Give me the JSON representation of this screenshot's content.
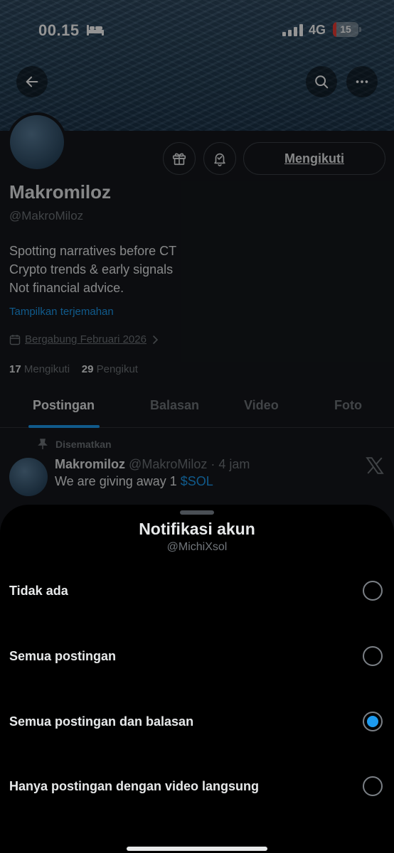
{
  "status_bar": {
    "time": "00.15",
    "network": "4G",
    "battery": "15",
    "battery_level": 0.15,
    "battery_color": "#eb3b35"
  },
  "profile": {
    "name": "Makromiloz",
    "handle": "@MakroMiloz",
    "follow_button": "Mengikuti",
    "bio_lines": [
      "Spotting narratives before CT",
      "Crypto trends & early signals",
      "Not financial advice."
    ],
    "translate_link": "Tampilkan terjemahan",
    "joined": "Bergabung Februari 2026",
    "following_count": "17",
    "following_label": "Mengikuti",
    "followers_count": "29",
    "followers_label": "Pengikut"
  },
  "tabs": [
    "Postingan",
    "Balasan",
    "Video",
    "Foto"
  ],
  "pinned_post": {
    "pinned_label": "Disematkan",
    "author": "Makromiloz",
    "handle_time": "@MakroMiloz · 4 jam",
    "text": "We are giving away 1 ",
    "cashtag": "$SOL"
  },
  "sheet": {
    "title": "Notifikasi akun",
    "subtitle": "@MichiXsol",
    "options": [
      {
        "label": "Tidak ada",
        "selected": false
      },
      {
        "label": "Semua postingan",
        "selected": false
      },
      {
        "label": "Semua postingan dan balasan",
        "selected": true
      },
      {
        "label": "Hanya postingan dengan video langsung",
        "selected": false
      }
    ]
  },
  "colors": {
    "accent": "#1d9bf0",
    "background": "#000000",
    "text": "#e7e9ea",
    "muted": "#71767b"
  },
  "icons": [
    "bed-icon",
    "signal-icon",
    "battery-icon",
    "back-arrow-icon",
    "search-icon",
    "more-icon",
    "gift-icon",
    "bell-icon",
    "calendar-icon",
    "chevron-right-icon",
    "pin-icon",
    "x-logo-icon"
  ]
}
